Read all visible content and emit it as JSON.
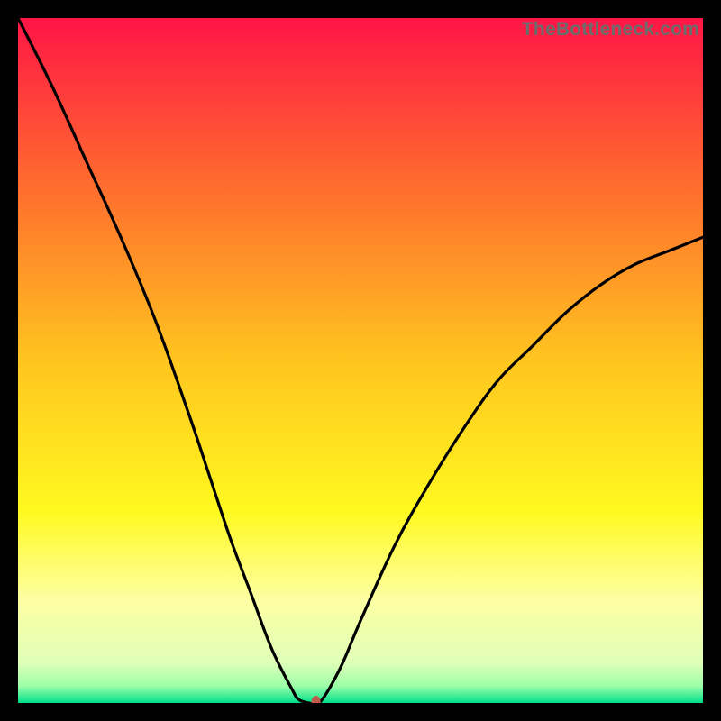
{
  "watermark": "TheBottleneck.com",
  "chart_data": {
    "type": "line",
    "title": "",
    "xlabel": "",
    "ylabel": "",
    "xlim": [
      0,
      100
    ],
    "ylim": [
      0,
      100
    ],
    "grid": false,
    "legend": false,
    "background_gradient": {
      "stops": [
        {
          "offset": 0.0,
          "color": "#ff1546"
        },
        {
          "offset": 0.25,
          "color": "#ff6e2e"
        },
        {
          "offset": 0.5,
          "color": "#ffc51f"
        },
        {
          "offset": 0.72,
          "color": "#fff91f"
        },
        {
          "offset": 0.85,
          "color": "#fdffa3"
        },
        {
          "offset": 0.94,
          "color": "#e0ffb7"
        },
        {
          "offset": 0.975,
          "color": "#9effa9"
        },
        {
          "offset": 1.0,
          "color": "#00e08a"
        }
      ]
    },
    "series": [
      {
        "name": "bottleneck-curve",
        "color": "#000000",
        "x": [
          0,
          5,
          10,
          15,
          20,
          25,
          28,
          31,
          34,
          37,
          40,
          41,
          42.5,
          44,
          47,
          50,
          55,
          60,
          65,
          70,
          75,
          80,
          85,
          90,
          95,
          100
        ],
        "y": [
          100,
          90,
          79,
          68,
          56,
          42,
          33,
          24,
          16,
          8,
          2,
          0.5,
          0,
          0,
          5,
          12,
          23,
          32,
          40,
          47,
          52,
          57,
          61,
          64,
          66,
          68
        ]
      }
    ],
    "marker": {
      "name": "optimum-point",
      "x": 43.5,
      "y": 0,
      "color": "#c05a4d",
      "rx": 5,
      "ry": 7
    }
  }
}
